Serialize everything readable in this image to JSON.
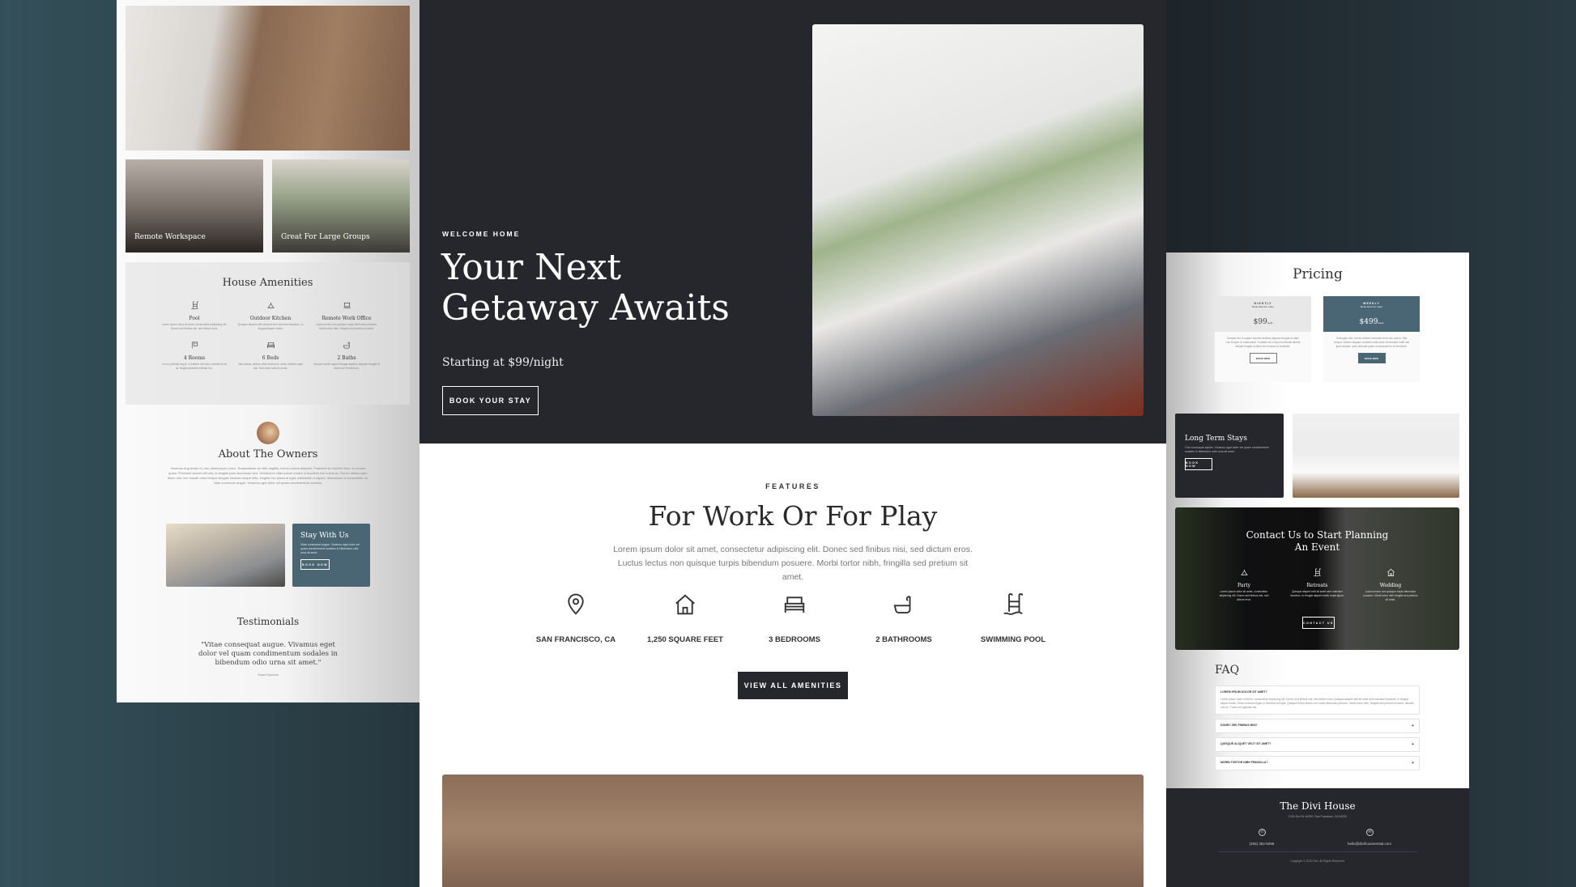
{
  "left": {
    "gallery": [
      {
        "label": "Remote Workspace"
      },
      {
        "label": "Great For Large Groups"
      }
    ],
    "amenities": {
      "title": "House Amenities",
      "items": [
        {
          "icon": "pool-ladder-icon",
          "label": "Pool",
          "text": "Lorem ipsum dolor sit amet, consectetur adipiscing elit. Donec sed finibus nisi, sed dictum eros."
        },
        {
          "icon": "grill-icon",
          "label": "Outdoor Kitchen",
          "text": "Quisque aliquet velit sit amet sem interdum faucibus. In feugiat aliquet mollis."
        },
        {
          "icon": "laptop-icon",
          "label": "Remote Work Office",
          "text": "Luctus lectus non quisque turpis bibendum posuere. Morbi tortor nibh, fringilla sed pretium sit amet."
        },
        {
          "icon": "door-icon",
          "label": "4 Rooms",
          "text": "In non pulvinar turpis. Curabitur nisi risus, blandit et est at, feugiat pharetra efficitur leo."
        },
        {
          "icon": "bed-icon",
          "label": "6 Beds",
          "text": "Nisi massa, dictum vitae viverra at, amet, ultricies eget orci. Sed vitae nulla et purus."
        },
        {
          "icon": "bathtub-icon",
          "label": "2 Baths",
          "text": "Semper sociis sapien feugiat dapibus aliquam feugiat ut diam non fermentum."
        }
      ]
    },
    "about": {
      "title": "About The Owners",
      "text": "Vivamus id gravida mi, nec ullamcorper purus. Suspendisse ac nibh sagittis, luctus viverra aliquam. Praesent ac lobortis risus, eu ornare quam. Praesent laoreet elit nisl, id feugiat justo accumsan sed. Vestibulum vitae ipsum ornare in faucibus nisi luctus ac. Donec ullamcorper libero nisl, nec blandit dolor tempor feugiat. Aenean neque felis, fringilla nec placerat eget, sollicitudin a sapien. Maecenas ut consectetur ex, vitae commodo augue. Vivamus eget dolor vel quam condimentum sodales."
    },
    "stay": {
      "title": "Stay With Us",
      "text": "Vitae consequat augue. Vivamus eget dolor vel quam condimentum sodales in bibendum odio urna sit amet.",
      "button": "BOOK NOW"
    },
    "testimonials": {
      "title": "Testimonials",
      "quote": "\"Vitae consequat augue. Vivamus eget dolor vel quam condimentum sodales in bibendum odio urna sit amet.\"",
      "author": "Susan Espinosa"
    }
  },
  "hero": {
    "eyebrow": "WELCOME HOME",
    "title": "Your Next Getaway Awaits",
    "subtitle": "Starting at $99/night",
    "button": "BOOK YOUR STAY"
  },
  "features": {
    "eyebrow": "FEATURES",
    "title": "For Work Or For Play",
    "text": "Lorem ipsum dolor sit amet, consectetur adipiscing elit. Donec sed finibus nisi, sed dictum eros. Luctus lectus non quisque turpis bibendum posuere. Morbi tortor nibh, fringilla sed pretium sit amet.",
    "items": [
      {
        "icon": "map-pin-icon",
        "label": "SAN FRANCISCO, CA"
      },
      {
        "icon": "house-icon",
        "label": "1,250 SQUARE FEET"
      },
      {
        "icon": "bed-icon",
        "label": "3 BEDROOMS"
      },
      {
        "icon": "bathtub-icon",
        "label": "2 BATHROOMS"
      },
      {
        "icon": "pool-ladder-icon",
        "label": "SWIMMING POOL"
      }
    ],
    "button": "VIEW ALL AMENITIES"
  },
  "right": {
    "pricing": {
      "title": "Pricing",
      "plans": [
        {
          "name": "NIGHTLY",
          "sub": "Book Now For Later",
          "price": "$99",
          "unit": "night",
          "text": "Semper dui ut sapien lobortis facilisis aliquam feugiat ut diam non tempor ut malesuada. Sodales leo et ipsum lobortis lacinia aliquet feugiat ut diam sed tempus in molestie.",
          "button": "BOOK NOW"
        },
        {
          "name": "WEEKLY",
          "sub": "Book Now For Later",
          "price": "$499",
          "unit": "week",
          "text": "In feugiat odio, donec ultrices interdum eros nec auctor. Nisi tempor ultrices aliquam sodales nulla dolor fermentum nulla nisl justo aliquet, quis vehicula quam consequat leo et hendrerit.",
          "button": "BOOK NOW"
        }
      ]
    },
    "long_term": {
      "title": "Long Term Stays",
      "text": "Orci consequat sapien. Vivamus eget dolor vel quam condimentum sodales in bibendum odio urna sit amet.",
      "button": "BOOK NOW"
    },
    "contact": {
      "title": "Contact Us to Start Planning An Event",
      "items": [
        {
          "icon": "grill-icon",
          "label": "Party",
          "text": "Lorem ipsum dolor sit amet, consectetur adipiscing elit. Donec sed finibus nisi, sed dictum eros."
        },
        {
          "icon": "pool-ladder-icon",
          "label": "Retreats",
          "text": "Quisque aliquet velit sit amet sem interdum faucibus. In feugiat aliquet mollis turpis ligula."
        },
        {
          "icon": "house-icon",
          "label": "Wedding",
          "text": "Luctus lectus non quisque turpis bibendum posuere. Morbi tortor nibh fringilla sed pretium sit amet."
        }
      ],
      "button": "CONTACT US"
    },
    "faq": {
      "title": "FAQ",
      "items": [
        {
          "q": "LOREM IPSUM DOLOR SIT AMET?",
          "a": "Lorem ipsum dolor sit amet, consectetur adipiscing elit. Donec sed finibus nisi, sed dictum eros. Quisque aliquet velit sit amet sem interdum faucibus. In feugiat aliquet mollis. Etiam tincidunt ligula ut hendrerit semper. Quisque luctus lectus non turpis bibendum posuere. Morbi tortor nibh, fringilla sed pretium sit amet, ultricies non ex. Fusce vel egestas nisl.",
          "open": true
        },
        {
          "q": "DONEC SED FINIBUS NISI?",
          "open": false
        },
        {
          "q": "QUISQUE ALIQUET VELIT SIT AMET?",
          "open": false
        },
        {
          "q": "MORBI TORTOR NIBH FRINGILLA?",
          "open": false
        }
      ]
    },
    "footer": {
      "title": "The Divi House",
      "address": "1234 Divi St. #1000, San Francisco, CA 94220",
      "phone": "(255) 352-6258",
      "email": "hello@divihouserental.com",
      "copyright": "Copyright © 2022 Divi. All Rights Reserved."
    }
  },
  "colors": {
    "dark": "#25272d",
    "accent": "#4a6674",
    "background": "#1f2a30"
  }
}
